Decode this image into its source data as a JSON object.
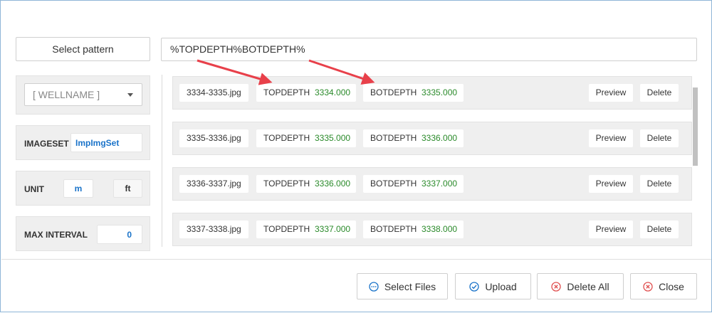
{
  "pattern": {
    "button_label": "Select pattern",
    "value": "%TOPDEPTH%BOTDEPTH%"
  },
  "wellname": {
    "value": "[ WELLNAME ]"
  },
  "imageset": {
    "label": "IMAGESET",
    "value": "ImpImgSet"
  },
  "unit": {
    "label": "UNIT",
    "options": [
      "m",
      "ft"
    ],
    "selected": "m"
  },
  "max_interval": {
    "label": "MAX INTERVAL",
    "value": "0"
  },
  "rows": [
    {
      "file": "3334-3335.jpg",
      "top_label": "TOPDEPTH",
      "top_value": "3334.000",
      "bot_label": "BOTDEPTH",
      "bot_value": "3335.000",
      "preview": "Preview",
      "delete": "Delete"
    },
    {
      "file": "3335-3336.jpg",
      "top_label": "TOPDEPTH",
      "top_value": "3335.000",
      "bot_label": "BOTDEPTH",
      "bot_value": "3336.000",
      "preview": "Preview",
      "delete": "Delete"
    },
    {
      "file": "3336-3337.jpg",
      "top_label": "TOPDEPTH",
      "top_value": "3336.000",
      "bot_label": "BOTDEPTH",
      "bot_value": "3337.000",
      "preview": "Preview",
      "delete": "Delete"
    },
    {
      "file": "3337-3338.jpg",
      "top_label": "TOPDEPTH",
      "top_value": "3337.000",
      "bot_label": "BOTDEPTH",
      "bot_value": "3338.000",
      "preview": "Preview",
      "delete": "Delete"
    }
  ],
  "footer": {
    "select_files": "Select Files",
    "upload": "Upload",
    "delete_all": "Delete All",
    "close": "Close"
  },
  "colors": {
    "accent_blue": "#1a73c9",
    "value_green": "#2a8a2a",
    "danger_red": "#e05050",
    "annotation_arrow": "#e8404a"
  },
  "icons": [
    "ellipsis-circle-icon",
    "check-circle-icon",
    "x-circle-icon",
    "x-circle-icon",
    "chevron-down-icon",
    "annotation-arrow"
  ]
}
